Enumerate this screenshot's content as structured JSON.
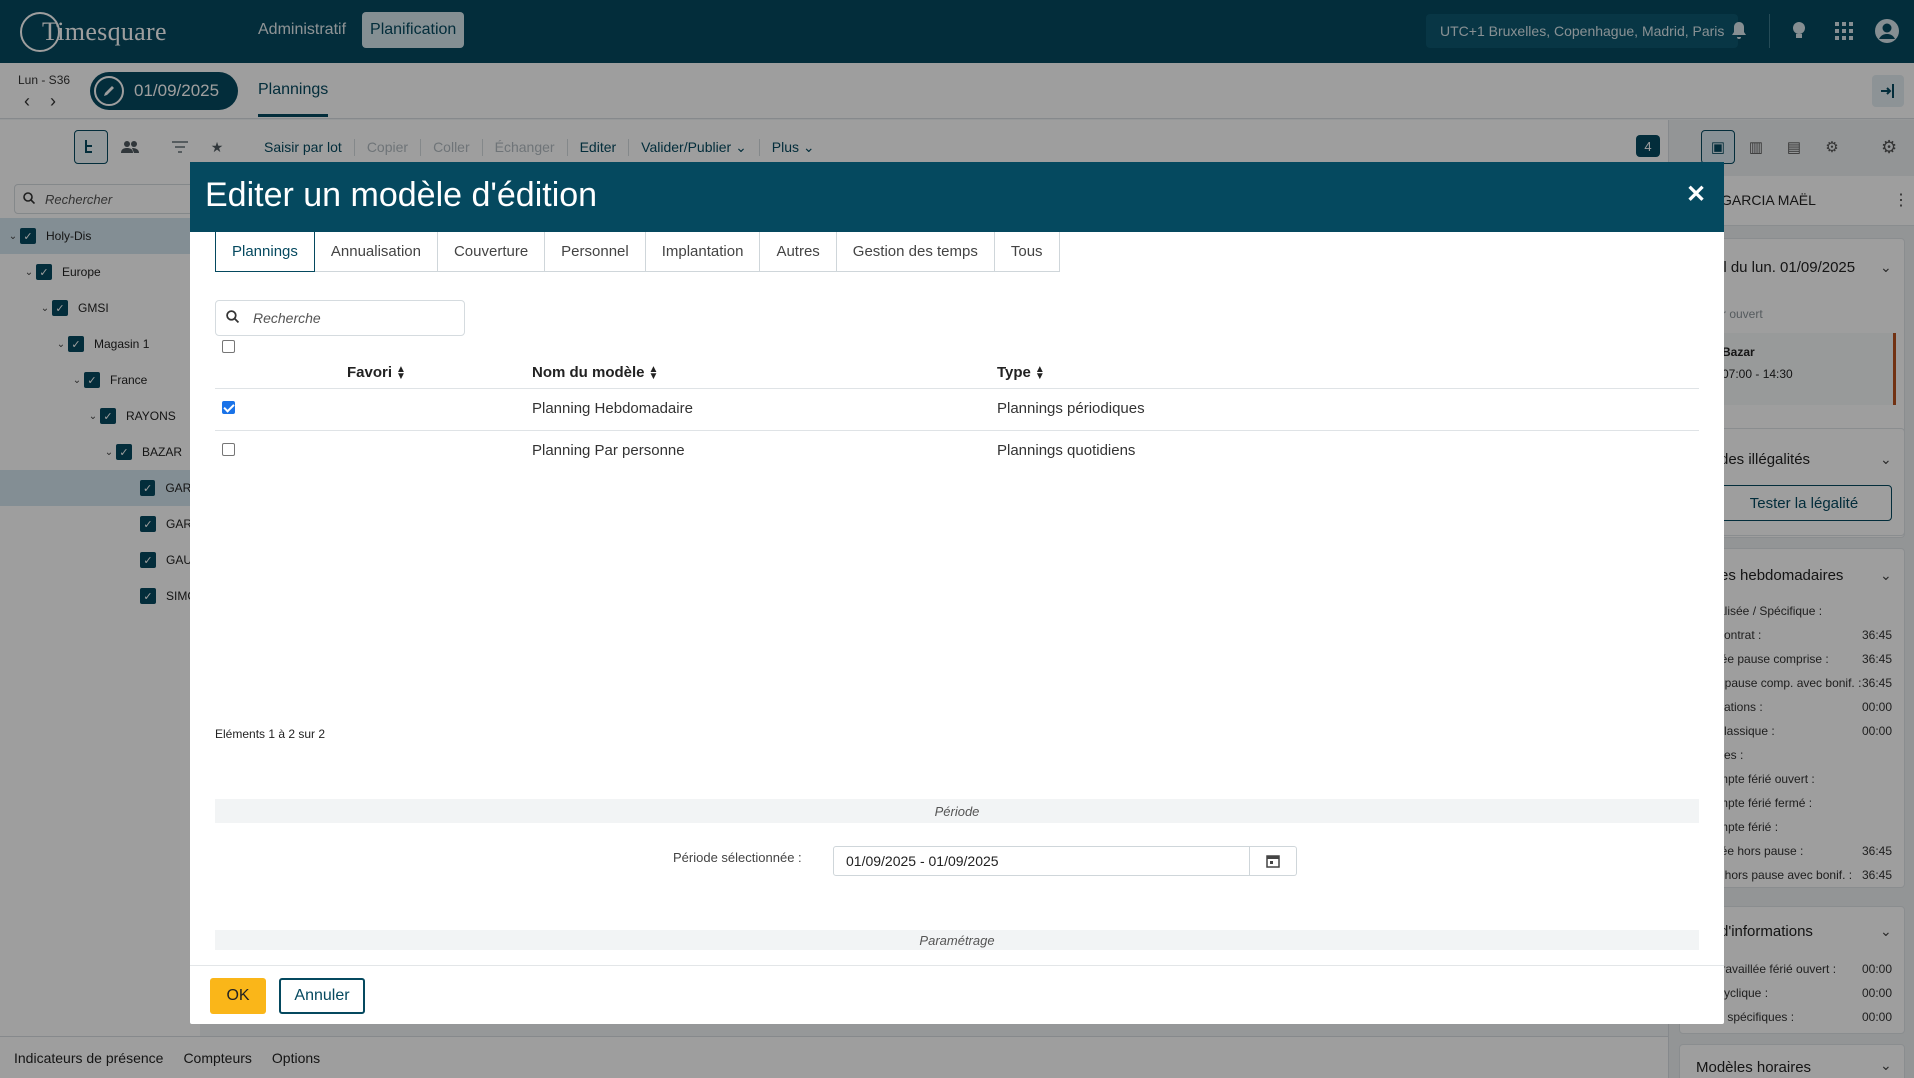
{
  "app": {
    "logo_text": "Timesquare",
    "nav": [
      "Administratif",
      "Planification"
    ],
    "timezone": "UTC+1 Bruxelles, Copenhague, Madrid, Paris"
  },
  "subheader": {
    "week_label": "Lun - S36",
    "date": "01/09/2025",
    "tab": "Plannings"
  },
  "toolbar": {
    "actions": [
      "Saisir par lot",
      "Copier",
      "Coller",
      "Échanger",
      "Editer",
      "Valider/Publier",
      "Plus"
    ],
    "badge": "4"
  },
  "left_tree": {
    "search_placeholder": "Rechercher",
    "nodes": [
      "Holy-Dis",
      "Europe",
      "GMSI",
      "Magasin 1",
      "France",
      "RAYONS",
      "BAZAR",
      "GARC",
      "GARI",
      "GAU",
      "SIMC"
    ]
  },
  "bottom_bar": {
    "items": [
      "Indicateurs de présence",
      "Compteurs",
      "Options"
    ]
  },
  "right_panel": {
    "employee": "GARCIA MAËL",
    "day_header": "il du lun. 01/09/2025",
    "day_status": "r ouvert",
    "slot_location": "Bazar",
    "slot_time": "07:00 - 14:30",
    "legality_title": "des illégalités",
    "legality_button": "Tester la légalité",
    "weekly_title": "es hebdomadaires",
    "weekly_lines": [
      {
        "label": "alisée / Spécifique :",
        "value": ""
      },
      {
        "label": "contrat :",
        "value": "36:45"
      },
      {
        "label": "iée pause comprise :",
        "value": "36:45"
      },
      {
        "label": ". pause comp. avec bonif. :",
        "value": "36:45"
      },
      {
        "label": "cations :",
        "value": "00:00"
      },
      {
        "label": "classique :",
        "value": "00:00"
      },
      {
        "label": "ces :",
        "value": ""
      },
      {
        "label": "mpte férié ouvert :",
        "value": ""
      },
      {
        "label": "mpte férié fermé :",
        "value": ""
      },
      {
        "label": "mpte férié :",
        "value": ""
      },
      {
        "label": "iée hors pause :",
        "value": "36:45"
      },
      {
        "label": ". hors pause avec bonif. :",
        "value": "36:45"
      }
    ],
    "info_title": "d'informations",
    "info_lines": [
      {
        "label": "travaillée férié ouvert :",
        "value": "00:00"
      },
      {
        "label": "cyclique :",
        "value": "00:00"
      },
      {
        "label": "s spécifiques :",
        "value": "00:00"
      }
    ],
    "models_title": "Modèles horaires"
  },
  "modal": {
    "title": "Editer un modèle d'édition",
    "tabs": [
      "Plannings",
      "Annualisation",
      "Couverture",
      "Personnel",
      "Implantation",
      "Autres",
      "Gestion des temps",
      "Tous"
    ],
    "active_tab": "Plannings",
    "search_placeholder": "Recherche",
    "columns": [
      "Favori",
      "Nom du modèle",
      "Type"
    ],
    "rows": [
      {
        "checked": true,
        "favori": "",
        "name": "Planning Hebdomadaire",
        "type": "Plannings périodiques"
      },
      {
        "checked": false,
        "favori": "",
        "name": "Planning Par personne",
        "type": "Plannings quotidiens"
      }
    ],
    "pager": "Eléments 1 à 2 sur 2",
    "period_section": "Période",
    "period_label": "Période sélectionnée :",
    "period_value": "01/09/2025 - 01/09/2025",
    "settings_section": "Paramétrage",
    "ok_label": "OK",
    "cancel_label": "Annuler"
  },
  "colors": {
    "primary": "#05495f",
    "accent": "#fab619",
    "overlay": "rgba(0,0,0,0.38)"
  }
}
